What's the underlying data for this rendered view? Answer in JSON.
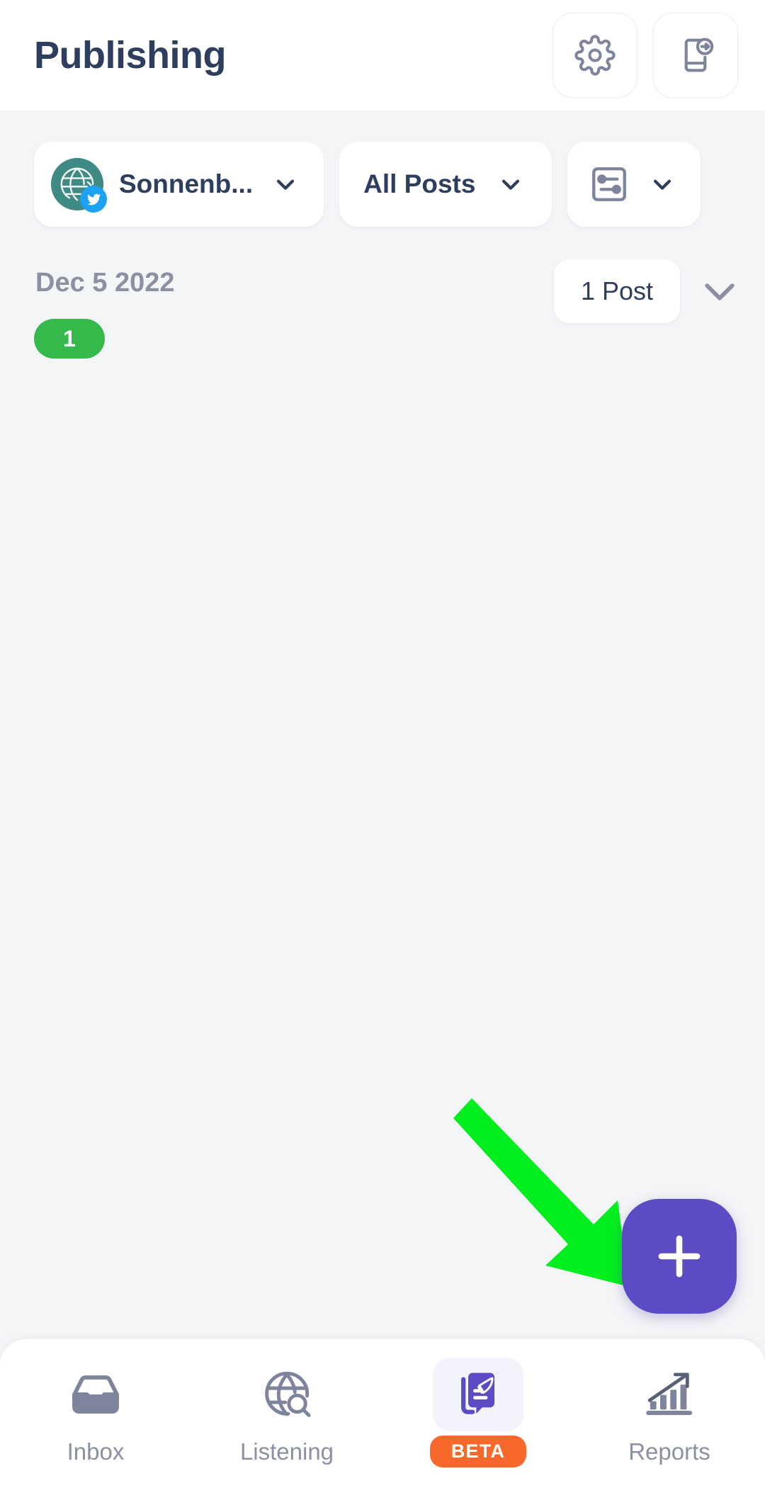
{
  "header": {
    "title": "Publishing",
    "actions": [
      {
        "name": "settings-button",
        "icon": "gear-icon"
      },
      {
        "name": "share-to-device-button",
        "icon": "device-export-icon"
      }
    ]
  },
  "filter_bar": {
    "account": {
      "label": "Sonnenb...",
      "avatar_color": "#3d8b84",
      "network_badge": "twitter-icon",
      "badge_color": "#1da1f2",
      "chevron": "chevron-down-icon"
    },
    "post_filter": {
      "label": "All Posts",
      "chevron": "chevron-down-icon"
    },
    "view_settings": {
      "icon": "sliders-icon",
      "chevron": "chevron-down-icon"
    }
  },
  "post_list": {
    "groups": [
      {
        "date": "Dec 5 2022",
        "count_badge": "1",
        "count_badge_color": "#35b94b",
        "post_count_label": "1 Post",
        "expand_chevron": "chevron-down-icon"
      }
    ]
  },
  "fab": {
    "name": "compose-button",
    "icon": "plus-icon",
    "color": "#5b4bc4"
  },
  "annotation": {
    "type": "arrow",
    "color": "#00ee1e",
    "points_to": "compose-button"
  },
  "bottom_nav": {
    "items": [
      {
        "label": "Inbox",
        "icon": "inbox-tray-icon",
        "active": false,
        "badge": null
      },
      {
        "label": "Listening",
        "icon": "globe-search-icon",
        "active": false,
        "badge": null
      },
      {
        "label": "",
        "icon": "publishing-rocket-icon",
        "active": true,
        "badge": "BETA"
      },
      {
        "label": "Reports",
        "icon": "bar-chart-arrow-icon",
        "active": false,
        "badge": null
      }
    ],
    "active_bg": "#f2f3fb",
    "badge_color": "#f8682a",
    "active_icon_color": "#5b4bc4",
    "inactive_icon_color": "#7d849b"
  }
}
